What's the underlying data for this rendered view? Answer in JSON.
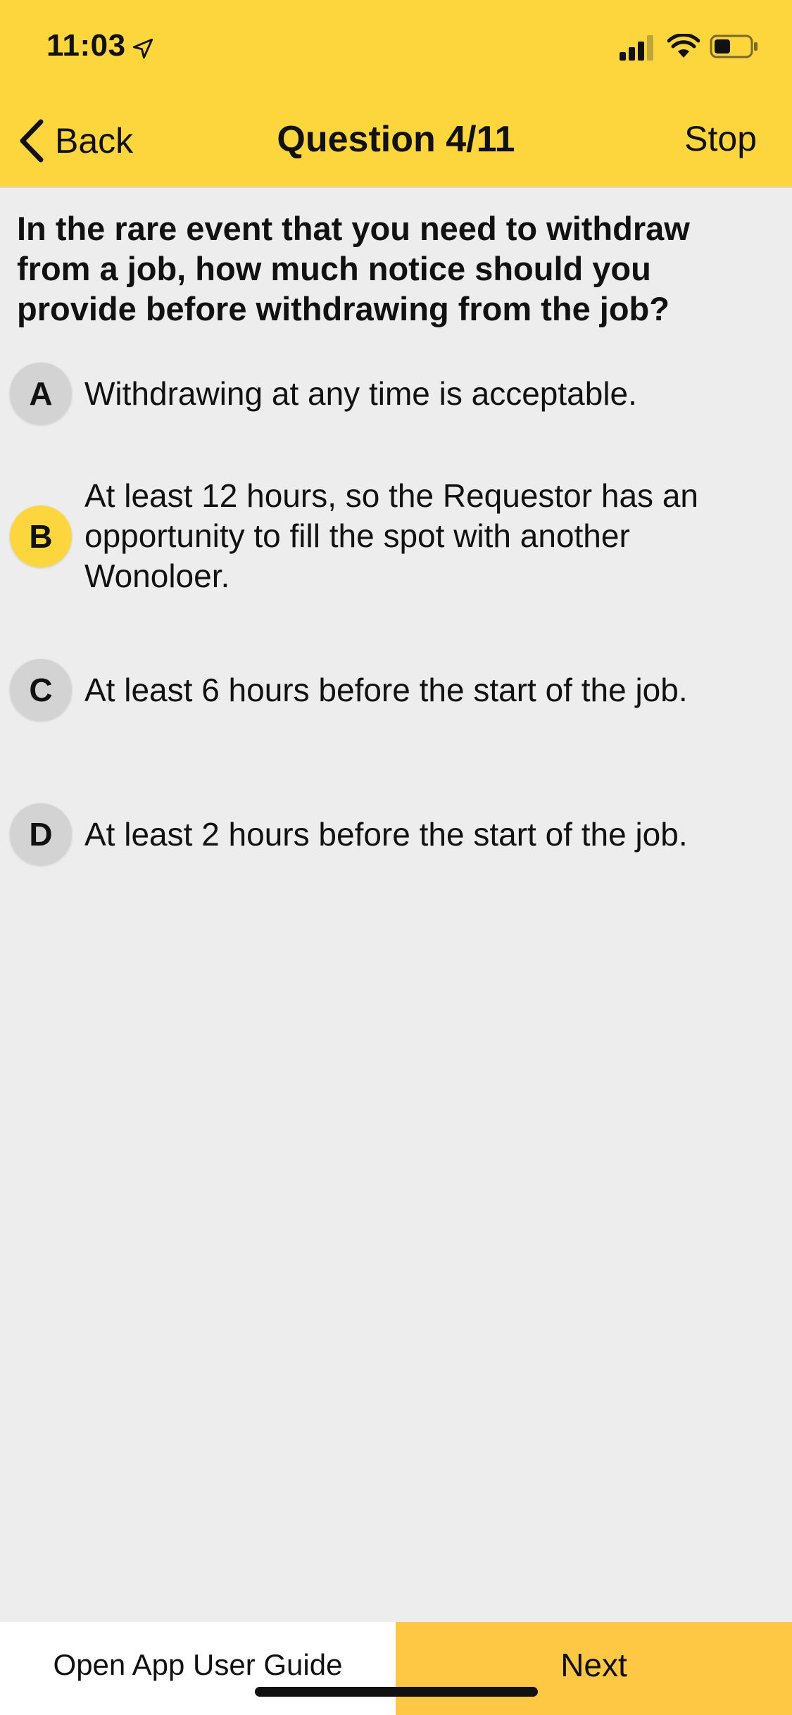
{
  "status_bar": {
    "time": "11:03",
    "icons": [
      "location-arrow-icon",
      "cellular-signal-icon",
      "wifi-icon",
      "battery-icon"
    ]
  },
  "nav": {
    "back_label": "Back",
    "title": "Question 4/11",
    "stop_label": "Stop"
  },
  "question": {
    "text": "In the rare event that you need to withdraw from a job, how much notice should you provide before withdrawing from the job?"
  },
  "answers": [
    {
      "letter": "A",
      "text": "Withdrawing at any time is acceptable.",
      "selected": false
    },
    {
      "letter": "B",
      "text": "At least 12 hours, so the Requestor has an opportunity to fill the spot with another Wonoloer.",
      "selected": true
    },
    {
      "letter": "C",
      "text": "At least 6 hours before the start of the job.",
      "selected": false
    },
    {
      "letter": "D",
      "text": "At least 2 hours before the start of the job.",
      "selected": false
    }
  ],
  "footer": {
    "guide_label": "Open App User Guide",
    "next_label": "Next"
  },
  "colors": {
    "accent": "#fdd63e",
    "next_button": "#fec845",
    "unselected_circle": "#d3d3d3",
    "background": "#ededed"
  }
}
